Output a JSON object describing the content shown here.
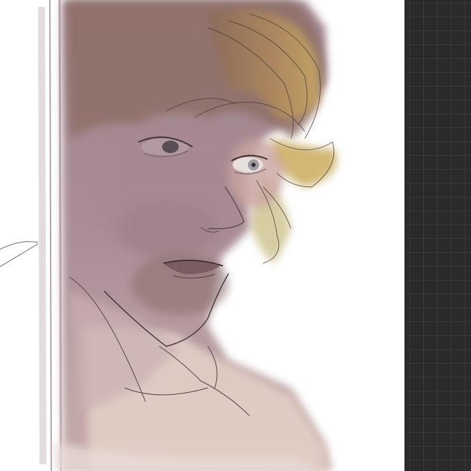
{
  "canvas": {
    "artwork": "portrait-sketch",
    "background_color": "#ffffff"
  },
  "panel": {
    "background_color": "#2a2a2c",
    "grid_color": "#3a3a3d"
  }
}
